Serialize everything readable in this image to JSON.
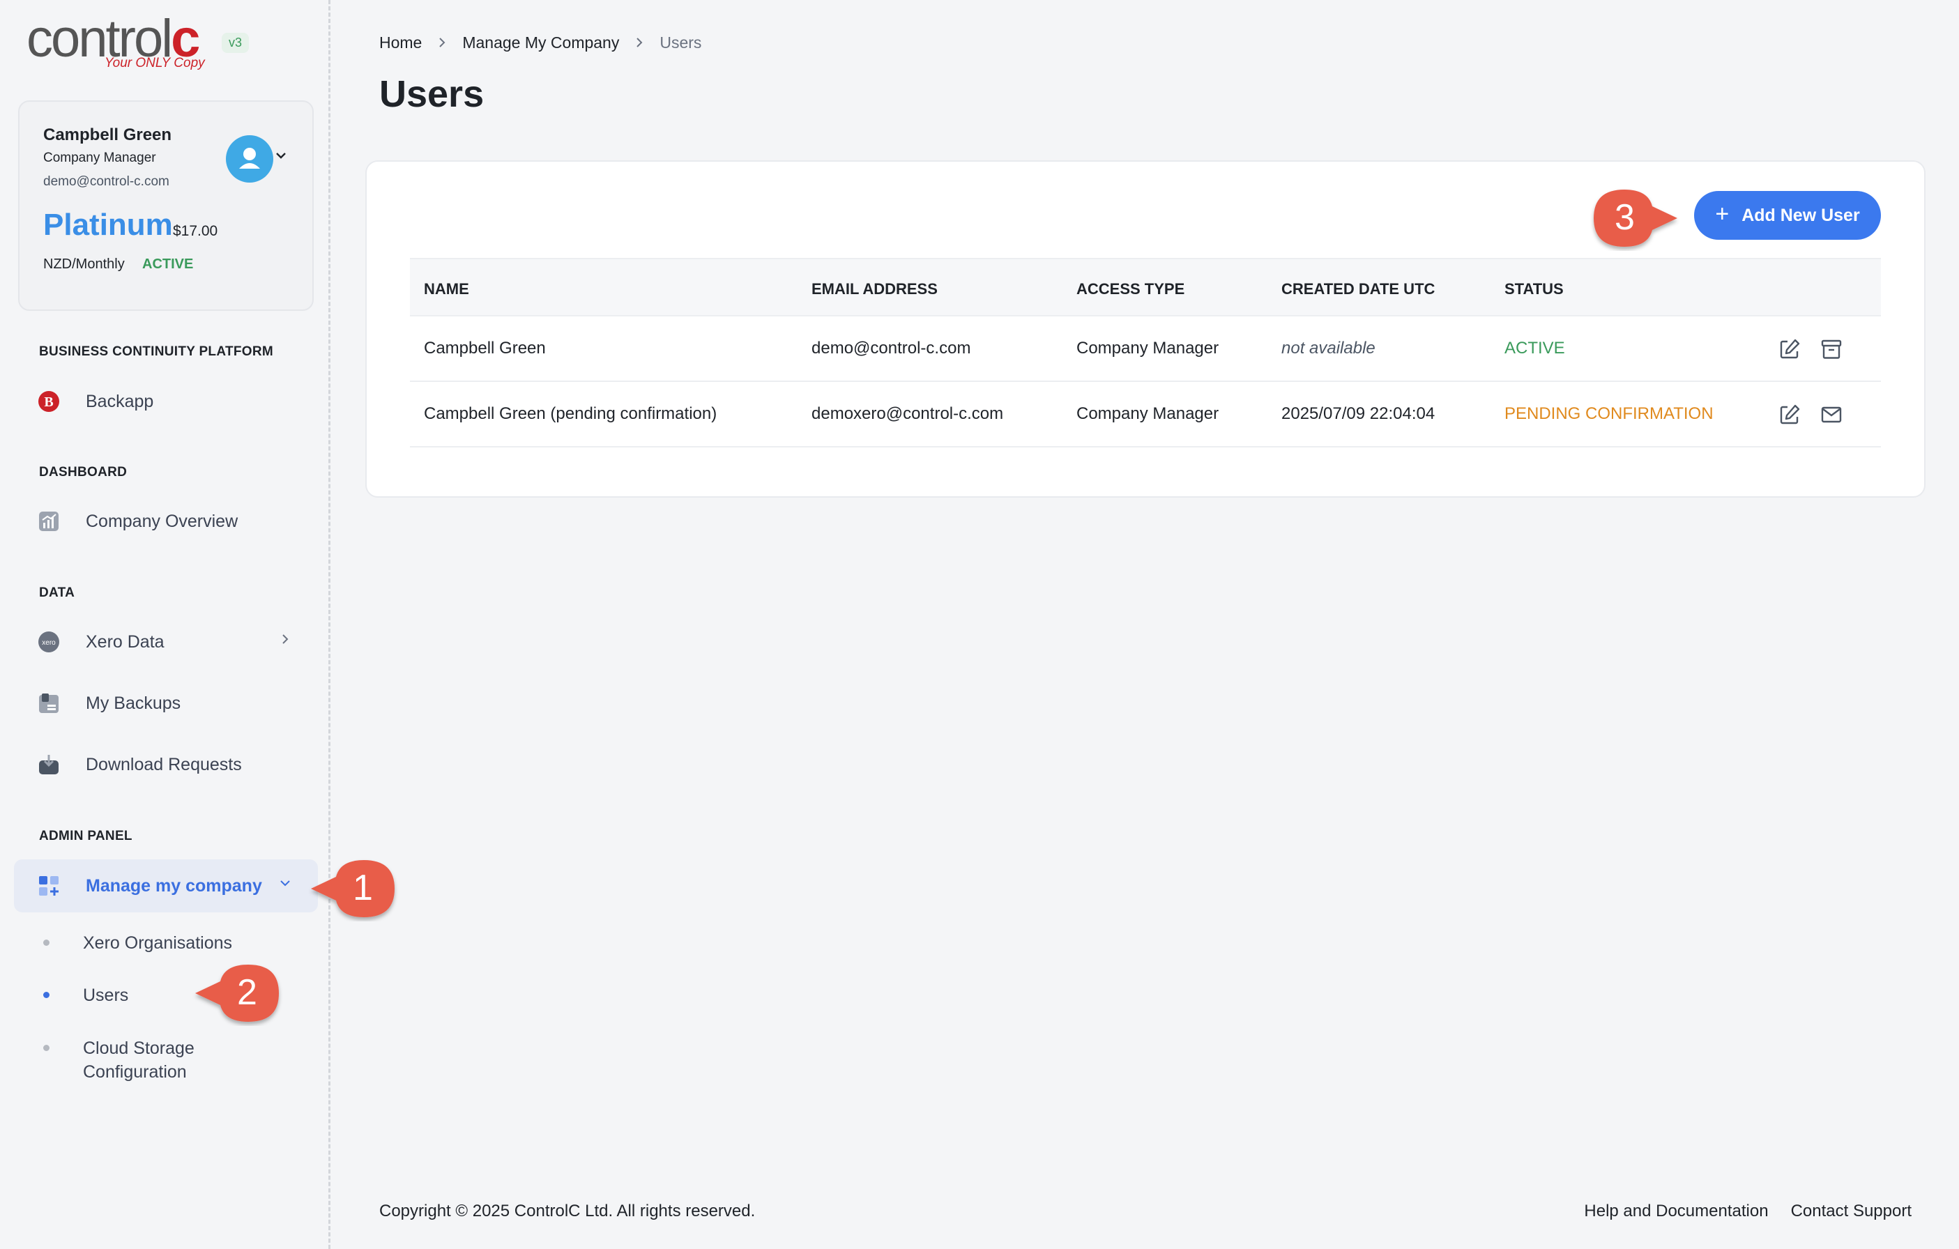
{
  "brand": {
    "word_main": "control",
    "word_accent": "c",
    "tagline": "Your ONLY Copy",
    "version": "v3"
  },
  "profile": {
    "name": "Campbell Green",
    "role": "Company Manager",
    "email": "demo@control-c.com",
    "plan": "Platinum",
    "price": "$17.00",
    "period": "NZD/Monthly",
    "status": "ACTIVE"
  },
  "sidebar": {
    "sections": [
      {
        "title": "BUSINESS CONTINUITY PLATFORM",
        "items": [
          {
            "label": "Backapp",
            "icon": "backapp-icon"
          }
        ]
      },
      {
        "title": "DASHBOARD",
        "items": [
          {
            "label": "Company Overview",
            "icon": "chart-icon"
          }
        ]
      },
      {
        "title": "DATA",
        "items": [
          {
            "label": "Xero Data",
            "icon": "xero-icon"
          },
          {
            "label": "My Backups",
            "icon": "backups-icon"
          },
          {
            "label": "Download Requests",
            "icon": "download-icon"
          }
        ]
      },
      {
        "title": "ADMIN PANEL",
        "items": [
          {
            "label": "Manage my company",
            "icon": "grid-plus-icon"
          }
        ]
      }
    ],
    "sub_items": [
      "Xero Organisations",
      "Users",
      "Cloud Storage",
      "Configuration"
    ]
  },
  "breadcrumb": [
    "Home",
    "Manage My Company",
    "Users"
  ],
  "page_title": "Users",
  "add_button": "Add New User",
  "table": {
    "headers": [
      "NAME",
      "EMAIL ADDRESS",
      "ACCESS TYPE",
      "CREATED DATE UTC",
      "STATUS"
    ],
    "rows": [
      {
        "name": "Campbell Green",
        "email": "demo@control-c.com",
        "access": "Company Manager",
        "created": "not available",
        "status": "ACTIVE"
      },
      {
        "name": "Campbell Green (pending confirmation)",
        "email": "demoxero@control-c.com",
        "access": "Company Manager",
        "created": "2025/07/09 22:04:04",
        "status": "PENDING CONFIRMATION"
      }
    ]
  },
  "footer": {
    "copyright": "Copyright © 2025 ControlC Ltd. All rights reserved.",
    "links": [
      "Help and Documentation",
      "Contact Support"
    ]
  },
  "callouts": [
    "1",
    "2",
    "3"
  ],
  "colors": {
    "accent": "#3b79ee",
    "active": "#3a9a5b",
    "pending": "#e08a1e",
    "callout": "#e85d4a",
    "brand_red": "#cc2229"
  }
}
